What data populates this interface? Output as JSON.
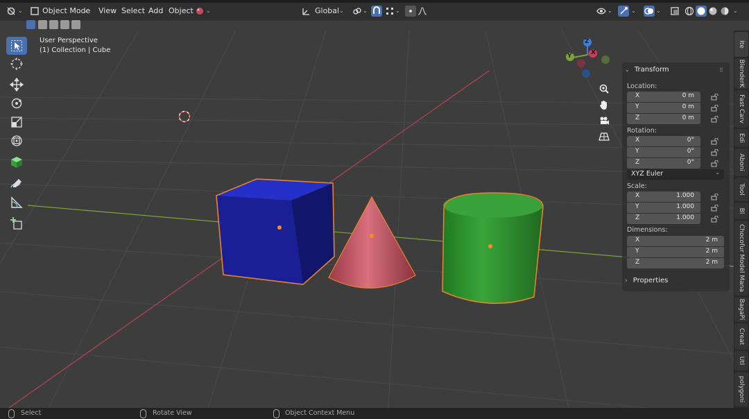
{
  "header": {
    "mode": "Object Mode",
    "menus": [
      "View",
      "Select",
      "Add",
      "Object"
    ],
    "transform_orientation": "Global"
  },
  "viewport": {
    "view_name": "User Perspective",
    "collection_info": "(1) Collection | Cube"
  },
  "toolbar": {
    "tools": [
      "select-box-tool",
      "cursor-tool",
      "move-tool",
      "rotate-tool",
      "scale-tool",
      "transform-tool",
      "add-cube-tool",
      "annotate-tool",
      "measure-tool",
      "add-object-tool"
    ]
  },
  "gizmo": {
    "x": "X",
    "y": "Y",
    "z": "Z"
  },
  "scene_objects": [
    {
      "name": "Cube",
      "color": "#1a1f8c",
      "selected": true
    },
    {
      "name": "Cone",
      "color": "#c9505e",
      "selected": true
    },
    {
      "name": "Cylinder",
      "color": "#2a8a2a",
      "selected": true
    }
  ],
  "n_panel": {
    "transform_title": "Transform",
    "location_label": "Location:",
    "location": [
      {
        "axis": "X",
        "value": "0 m"
      },
      {
        "axis": "Y",
        "value": "0 m"
      },
      {
        "axis": "Z",
        "value": "0 m"
      }
    ],
    "rotation_label": "Rotation:",
    "rotation": [
      {
        "axis": "X",
        "value": "0°"
      },
      {
        "axis": "Y",
        "value": "0°"
      },
      {
        "axis": "Z",
        "value": "0°"
      }
    ],
    "rotation_mode": "XYZ Euler",
    "scale_label": "Scale:",
    "scale": [
      {
        "axis": "X",
        "value": "1.000"
      },
      {
        "axis": "Y",
        "value": "1.000"
      },
      {
        "axis": "Z",
        "value": "1.000"
      }
    ],
    "dimensions_label": "Dimensions:",
    "dimensions": [
      {
        "axis": "X",
        "value": "2 m"
      },
      {
        "axis": "Y",
        "value": "2 m"
      },
      {
        "axis": "Z",
        "value": "2 m"
      }
    ],
    "properties_title": "Properties"
  },
  "side_tabs": [
    "Ite",
    "BlenderK",
    "Fast Carv",
    "Edi",
    "Aboni",
    "Tool",
    "Bl",
    "Chocofur Model Mana",
    "BagaPi",
    "Creat",
    "Utl",
    "polygoni"
  ],
  "status_bar": {
    "select": "Select",
    "rotate_view": "Rotate View",
    "context_menu": "Object Context Menu"
  },
  "colors": {
    "accent": "#4a70b0",
    "selection_outline": "#e8822e",
    "x_axis": "#c9405a",
    "y_axis": "#7ea33a",
    "z_axis": "#3f7fd8"
  }
}
